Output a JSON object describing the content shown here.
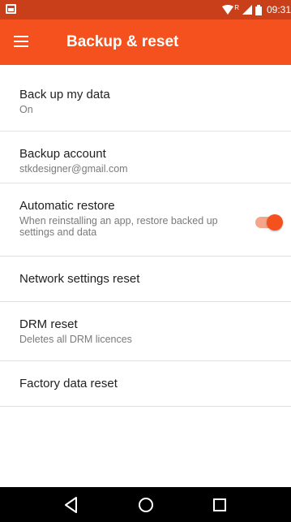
{
  "status_bar": {
    "time": "09:31",
    "network": "R",
    "icons": [
      "notification-icon",
      "wifi-icon",
      "cell-signal-icon",
      "battery-icon"
    ]
  },
  "app_bar": {
    "title": "Backup & reset",
    "menu_icon": "hamburger-menu-icon",
    "color": "#f4511e",
    "status_color": "#c93f1a"
  },
  "settings": {
    "backup_data": {
      "title": "Back up my data",
      "summary": "On"
    },
    "backup_account": {
      "title": "Backup account",
      "summary": "stkdesigner@gmail.com"
    },
    "auto_restore": {
      "title": "Automatic restore",
      "summary": "When reinstalling an app, restore backed up settings and data",
      "enabled": true
    },
    "network_reset": {
      "title": "Network settings reset"
    },
    "drm_reset": {
      "title": "DRM reset",
      "summary": "Deletes all DRM licences"
    },
    "factory_reset": {
      "title": "Factory data reset"
    }
  },
  "nav_bar": {
    "buttons": [
      "back-icon",
      "home-icon",
      "recents-icon"
    ]
  }
}
